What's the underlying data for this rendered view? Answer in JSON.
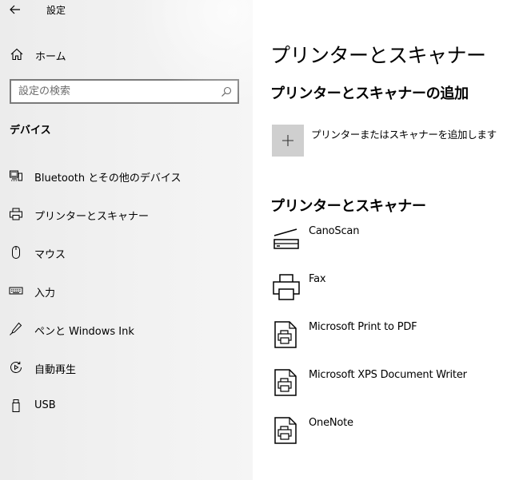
{
  "titlebar": {
    "title": "設定"
  },
  "sidebar": {
    "home_label": "ホーム",
    "search_placeholder": "設定の検索",
    "section_heading": "デバイス",
    "items": [
      {
        "label": "Bluetooth とその他のデバイス",
        "icon": "bluetooth-devices-icon"
      },
      {
        "label": "プリンターとスキャナー",
        "icon": "printer-icon"
      },
      {
        "label": "マウス",
        "icon": "mouse-icon"
      },
      {
        "label": "入力",
        "icon": "keyboard-icon"
      },
      {
        "label": "ペンと Windows Ink",
        "icon": "pen-icon"
      },
      {
        "label": "自動再生",
        "icon": "autoplay-icon"
      },
      {
        "label": "USB",
        "icon": "usb-icon"
      }
    ]
  },
  "main": {
    "title": "プリンターとスキャナー",
    "add_section_title": "プリンターとスキャナーの追加",
    "add_button_label": "プリンターまたはスキャナーを追加します",
    "list_title": "プリンターとスキャナー",
    "devices": [
      {
        "name": "CanoScan",
        "icon": "scanner-icon"
      },
      {
        "name": "Fax",
        "icon": "printer-icon"
      },
      {
        "name": "Microsoft Print to PDF",
        "icon": "document-printer-icon"
      },
      {
        "name": "Microsoft XPS Document Writer",
        "icon": "document-printer-icon"
      },
      {
        "name": "OneNote",
        "icon": "document-printer-icon"
      }
    ]
  }
}
